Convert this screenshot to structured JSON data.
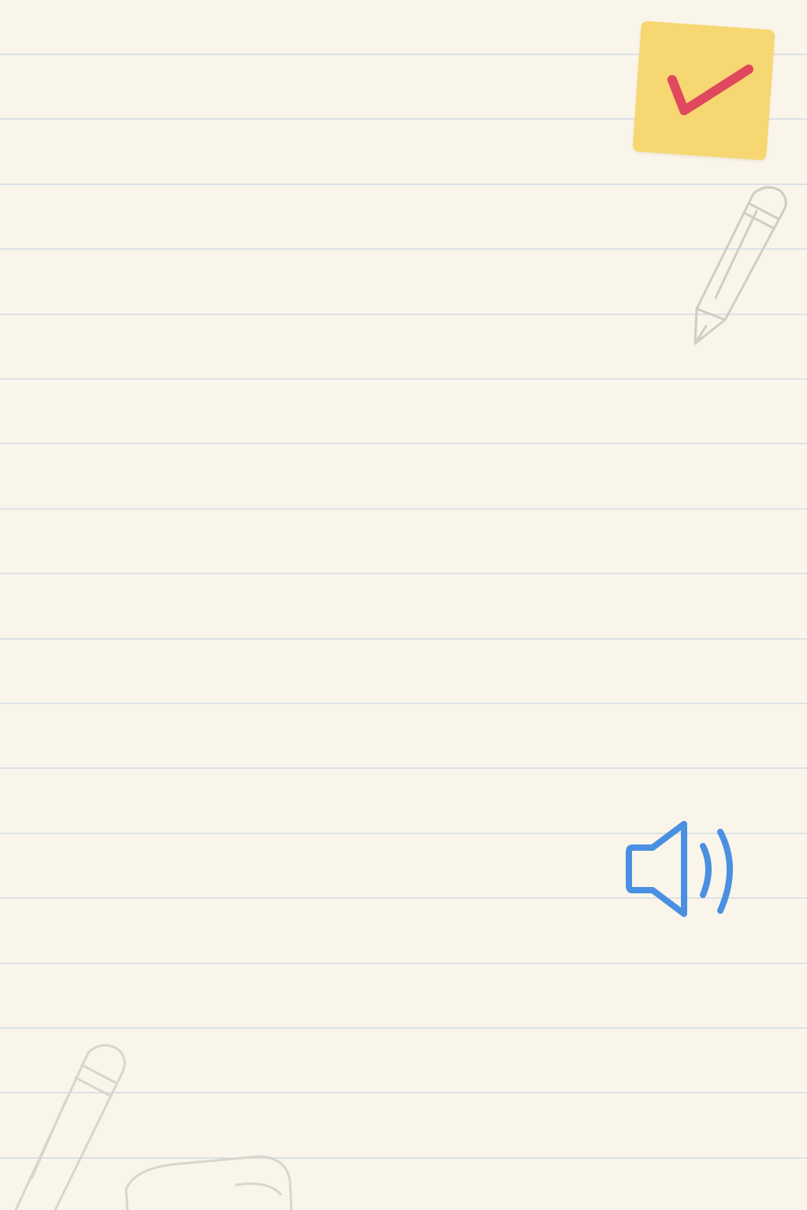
{
  "page": {
    "background_color": "#faf5ea",
    "rule_color": "#d6dde6"
  },
  "sticky_note": {
    "icon": "checkmark-icon",
    "note_color": "#f7d772",
    "check_color": "#e0485e"
  },
  "decorations": {
    "icons": [
      "pencil-icon",
      "pencil-icon",
      "eraser-icon"
    ],
    "sketch_color": "#cfcdc5"
  },
  "audio_button": {
    "icon": "speaker-icon",
    "color": "#4a90e2"
  }
}
